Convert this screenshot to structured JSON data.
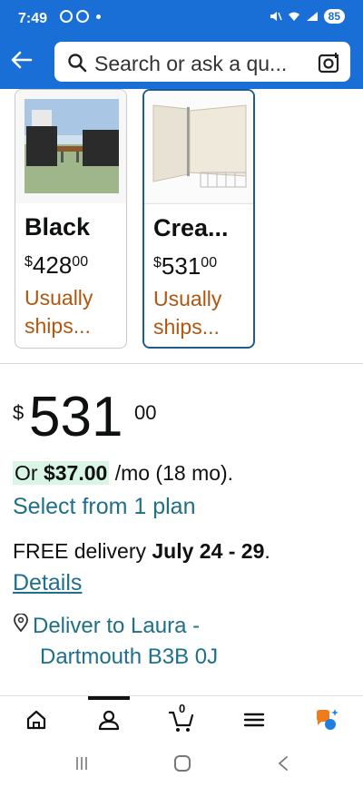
{
  "status_bar": {
    "time": "7:49",
    "battery": "85"
  },
  "search": {
    "placeholder": "Search or ask a qu..."
  },
  "variants": [
    {
      "name": "Black",
      "price_symbol": "$",
      "price_whole": "428",
      "price_cents": "00",
      "shipping": "Usually ships...",
      "selected": false
    },
    {
      "name": "Crea...",
      "price_symbol": "$",
      "price_whole": "531",
      "price_cents": "00",
      "shipping": "Usually ships...",
      "selected": true
    }
  ],
  "price": {
    "symbol": "$",
    "whole": "531",
    "cents": "00"
  },
  "installment": {
    "prefix": "Or",
    "amount": "$37.00",
    "suffix": "/mo (18 mo).",
    "plan_link": "Select from 1 plan"
  },
  "delivery": {
    "prefix": "FREE delivery",
    "dates": "July 24 - 29",
    "suffix": ".",
    "details_link": "Details"
  },
  "deliver_to": {
    "line1": "Deliver to Laura -",
    "line2": "Dartmouth B3B 0J"
  },
  "bottom_nav": {
    "cart_count": "0"
  },
  "colors": {
    "header_blue": "#1a6fd6",
    "link": "#1f6f8b",
    "shipping_orange": "#b1560f",
    "selected_border": "#1f5c8d"
  }
}
